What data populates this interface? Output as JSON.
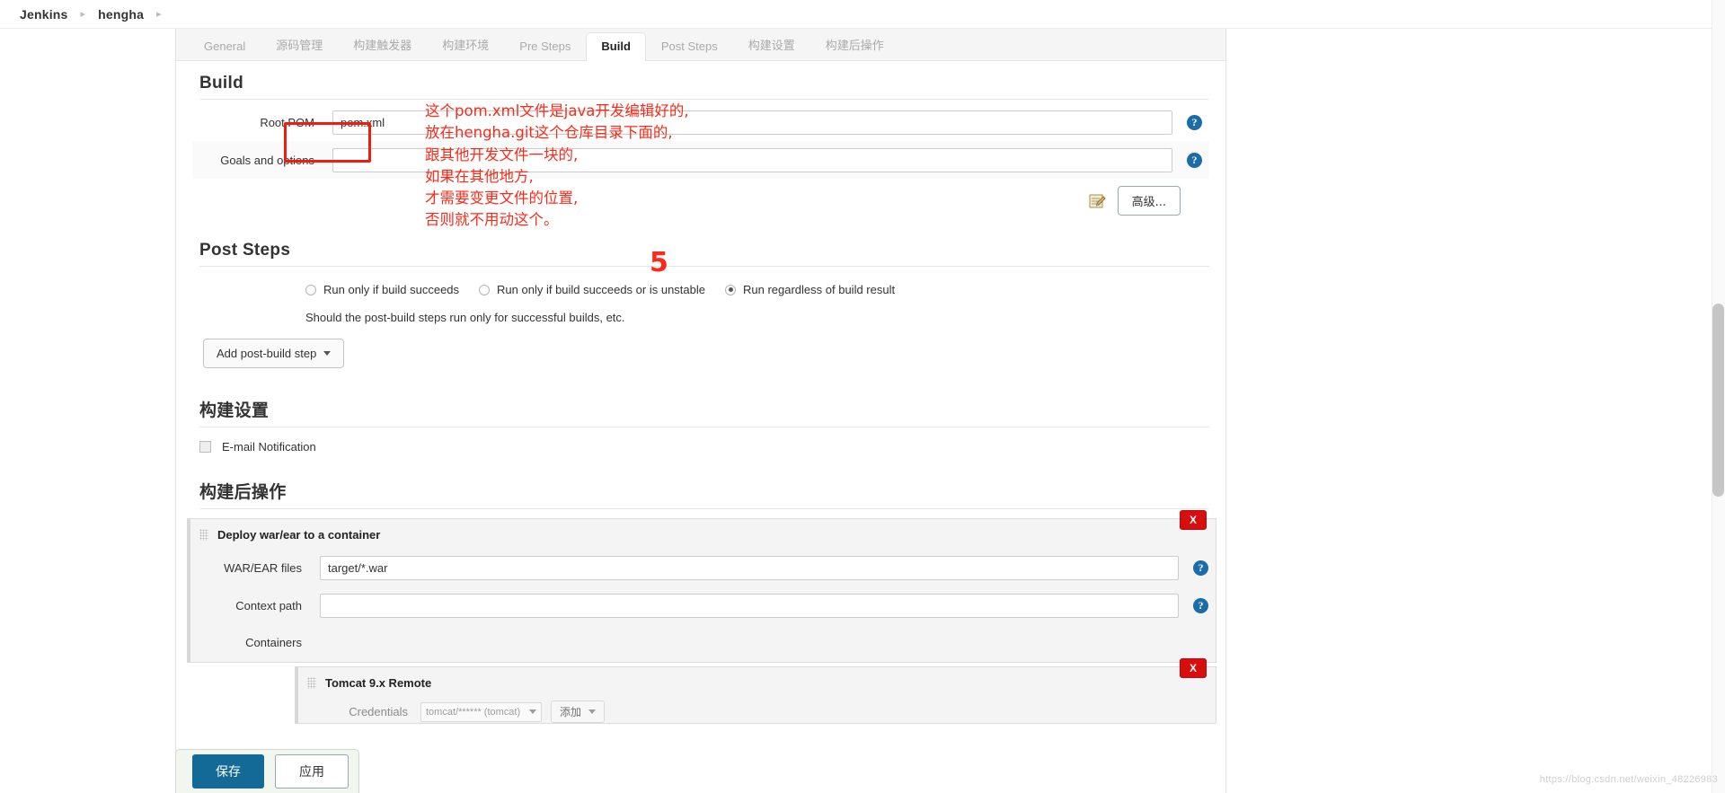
{
  "breadcrumb": {
    "root": "Jenkins",
    "project": "hengha"
  },
  "tabs": [
    {
      "label": "General",
      "active": false
    },
    {
      "label": "源码管理",
      "active": false
    },
    {
      "label": "构建触发器",
      "active": false
    },
    {
      "label": "构建环境",
      "active": false
    },
    {
      "label": "Pre Steps",
      "active": false
    },
    {
      "label": "Build",
      "active": true
    },
    {
      "label": "Post Steps",
      "active": false
    },
    {
      "label": "构建设置",
      "active": false
    },
    {
      "label": "构建后操作",
      "active": false
    }
  ],
  "build": {
    "title": "Build",
    "root_pom_label": "Root POM",
    "root_pom_value": "pom.xml",
    "goals_label": "Goals and options",
    "goals_value": "",
    "advanced_label": "高级..."
  },
  "annotation": {
    "lines": [
      "这个pom.xml文件是java开发编辑好的,",
      "放在hengha.git这个仓库目录下面的,",
      "跟其他开发文件一块的,",
      "如果在其他地方,",
      "才需要变更文件的位置,",
      "否则就不用动这个。"
    ],
    "step_number": "5",
    "color": "#fb2a19"
  },
  "post_steps": {
    "title": "Post Steps",
    "options": [
      {
        "label": "Run only if build succeeds",
        "selected": false
      },
      {
        "label": "Run only if build succeeds or is unstable",
        "selected": false
      },
      {
        "label": "Run regardless of build result",
        "selected": true
      }
    ],
    "hint": "Should the post-build steps run only for successful builds, etc.",
    "add_button": "Add post-build step"
  },
  "build_settings": {
    "title": "构建设置",
    "email_label": "E-mail Notification",
    "email_checked": false
  },
  "post_build_actions": {
    "title": "构建后操作",
    "deploy": {
      "panel_title": "Deploy war/ear to a container",
      "delete_label": "X",
      "war_label": "WAR/EAR files",
      "war_value": "target/*.war",
      "context_label": "Context path",
      "context_value": "",
      "containers_label": "Containers",
      "container_title": "Tomcat 9.x Remote",
      "credentials_label": "Credentials",
      "credentials_value": "tomcat/****** (tomcat)",
      "add_label": "添加"
    }
  },
  "actionbar": {
    "save": "保存",
    "apply": "应用"
  },
  "watermark": "https://blog.csdn.net/weixin_48226983"
}
